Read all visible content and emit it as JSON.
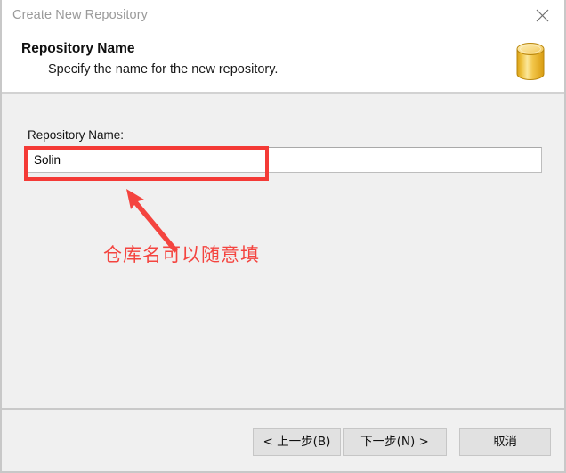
{
  "window": {
    "title": "Create New Repository",
    "close_icon": "close-x-icon",
    "title_color": "#9a9a9a"
  },
  "header": {
    "title": "Repository Name",
    "subtitle": "Specify the name for the new repository.",
    "icon": "database-cylinder-icon",
    "icon_color": "#e8b221"
  },
  "form": {
    "label": "Repository Name:",
    "value": "Solin",
    "placeholder": ""
  },
  "annotations": {
    "highlight_color": "#f43a36",
    "arrow_icon": "arrow-up-left-icon",
    "note_text": "仓库名可以随意填"
  },
  "footer": {
    "back_label": "< 上一步(B)",
    "next_label": "下一步(N) >",
    "cancel_label": "取消"
  }
}
